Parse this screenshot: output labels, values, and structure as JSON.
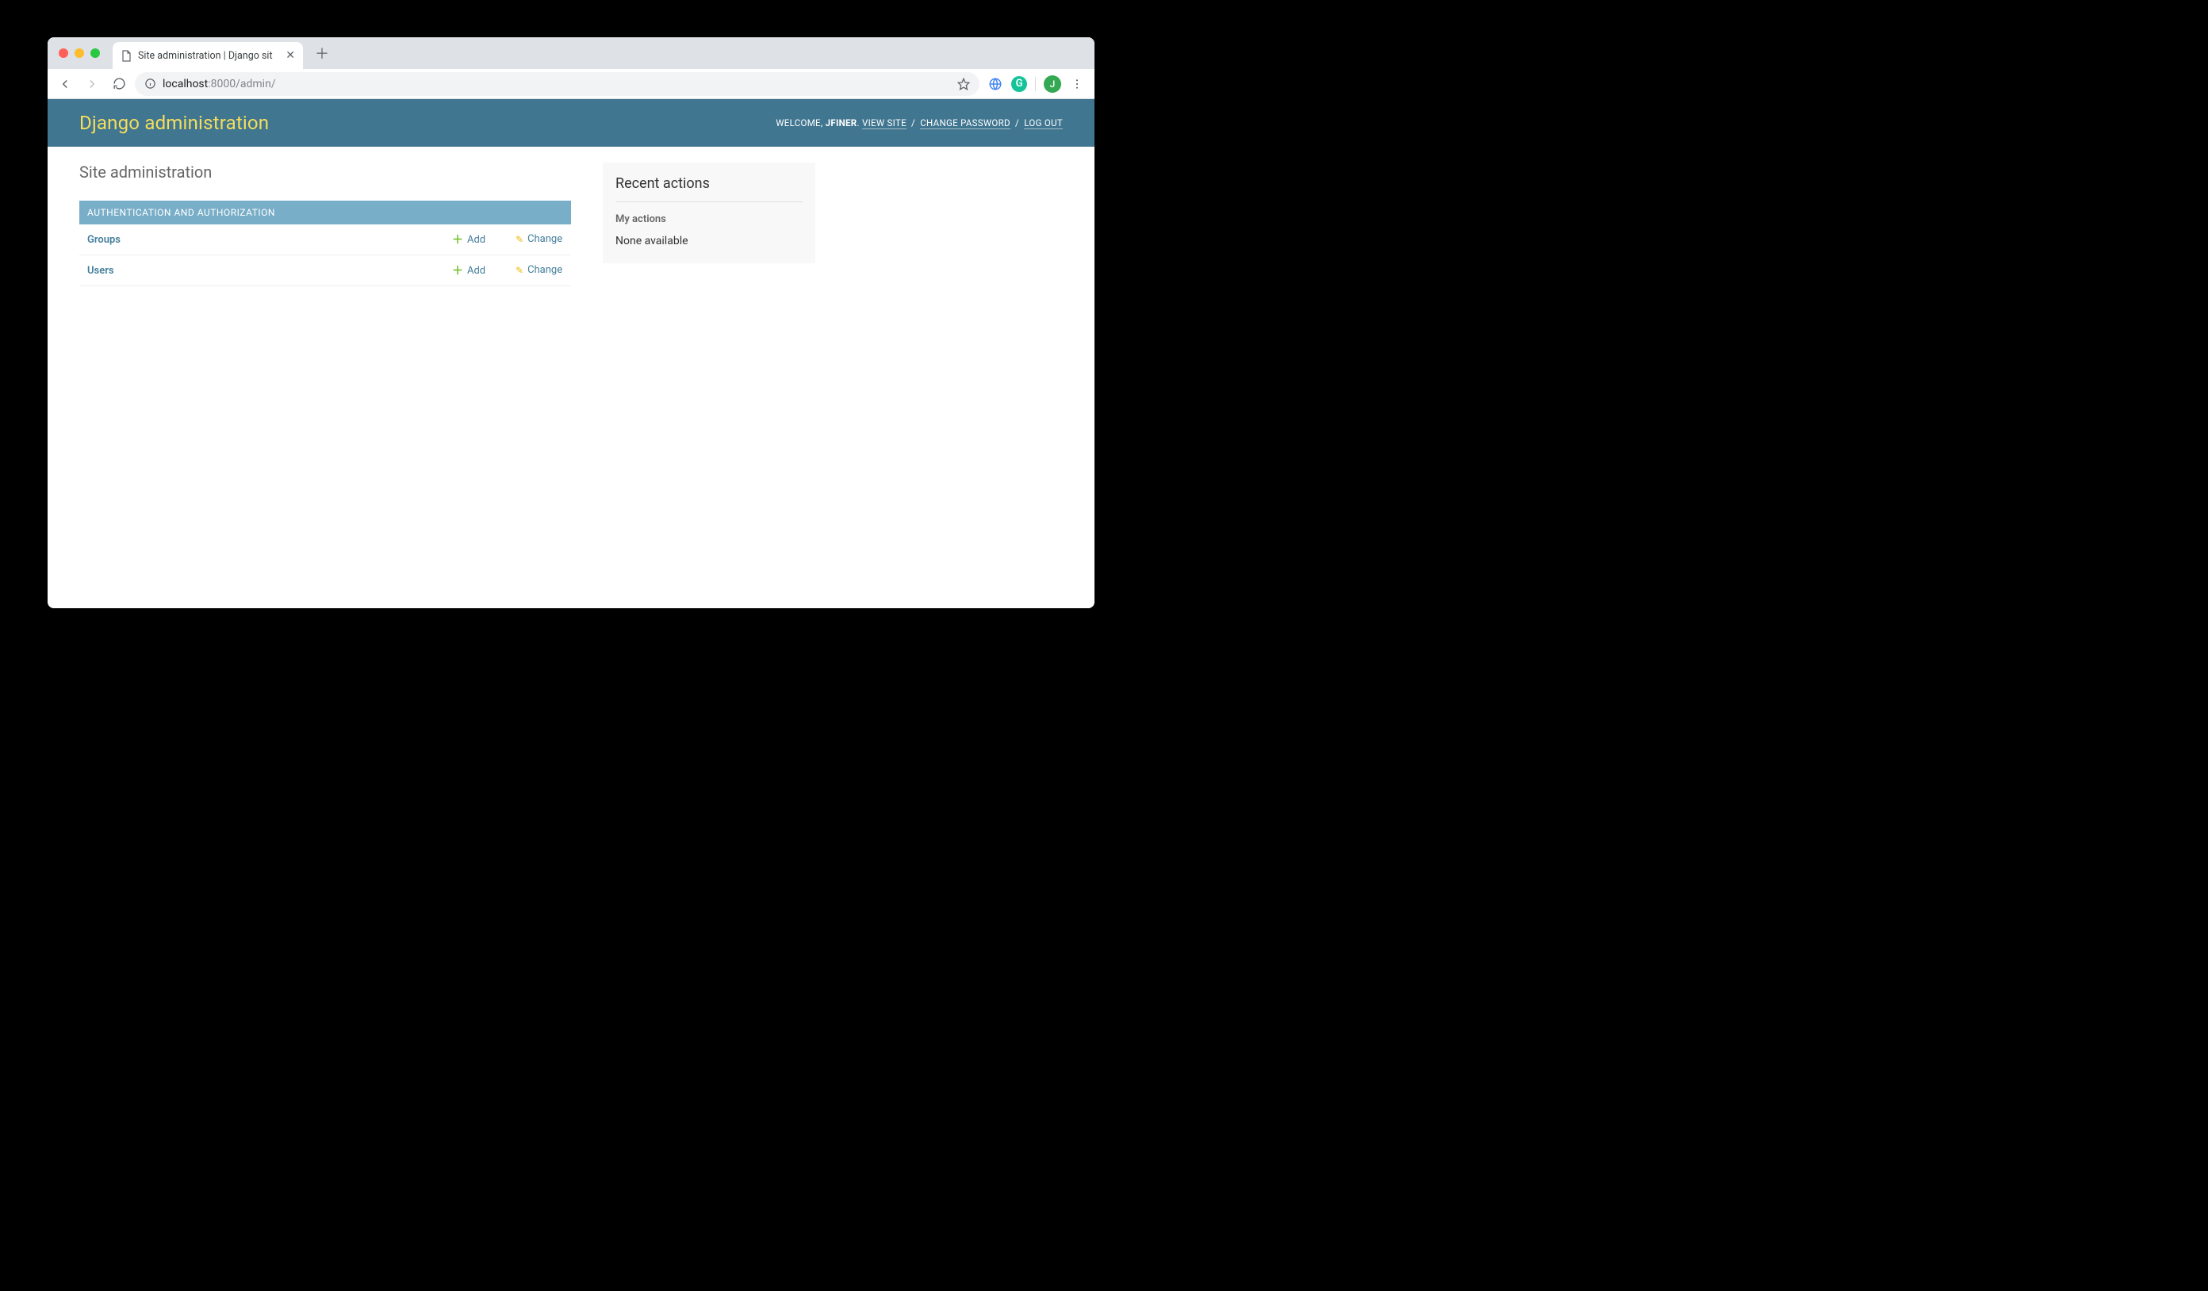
{
  "browser": {
    "tab_title": "Site administration | Django sit",
    "url_host": "localhost",
    "url_port_path": ":8000/admin/",
    "avatar_letter": "J",
    "grammarly_letter": "G"
  },
  "header": {
    "branding": "Django administration",
    "welcome": "WELCOME, ",
    "username": "JFINER",
    "view_site": "VIEW SITE",
    "change_password": "CHANGE PASSWORD",
    "log_out": "LOG OUT"
  },
  "page": {
    "title": "Site administration"
  },
  "app": {
    "name": "AUTHENTICATION AND AUTHORIZATION",
    "models": [
      {
        "name": "Groups",
        "add": "Add",
        "change": "Change"
      },
      {
        "name": "Users",
        "add": "Add",
        "change": "Change"
      }
    ]
  },
  "recent": {
    "heading": "Recent actions",
    "subheading": "My actions",
    "empty": "None available"
  }
}
